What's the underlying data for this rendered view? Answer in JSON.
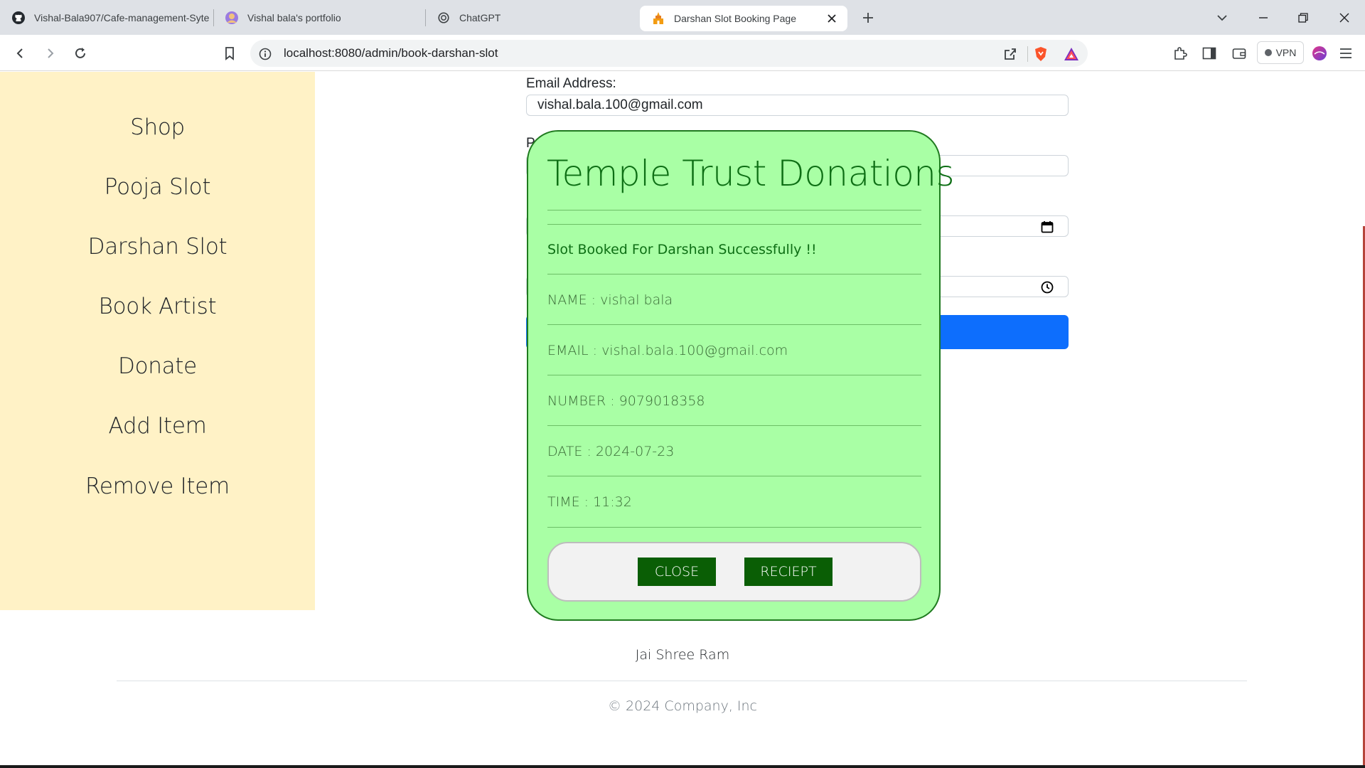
{
  "browser": {
    "tabs": [
      {
        "title": "Vishal-Bala907/Cafe-management-Syte",
        "icon": "github-icon"
      },
      {
        "title": "Vishal bala's portfolio",
        "icon": "avatar-icon"
      },
      {
        "title": "ChatGPT",
        "icon": "chatgpt-icon"
      },
      {
        "title": "Darshan Slot Booking Page",
        "icon": "temple-icon",
        "active": true
      }
    ],
    "url": "localhost:8080/admin/book-darshan-slot",
    "vpn_label": "VPN"
  },
  "sidebar": {
    "items": [
      {
        "label": "Shop"
      },
      {
        "label": "Pooja Slot"
      },
      {
        "label": "Darshan Slot"
      },
      {
        "label": "Book Artist"
      },
      {
        "label": "Donate"
      },
      {
        "label": "Add Item"
      },
      {
        "label": "Remove Item"
      }
    ]
  },
  "form": {
    "email_label": "Email Address:",
    "email_value": "vishal.bala.100@gmail.com",
    "phone_label_partial": "P",
    "submit_color": "#0d6efd"
  },
  "modal": {
    "title": "Temple Trust Donations",
    "message": "Slot Booked For Darshan Successfully !!",
    "rows": [
      {
        "text": "NAME : vishal bala"
      },
      {
        "text": "EMAIL : vishal.bala.100@gmail.com"
      },
      {
        "text": "NUMBER : 9079018358"
      },
      {
        "text": "DATE : 2024-07-23"
      },
      {
        "text": "TIME : 11:32"
      }
    ],
    "close_label": "CLOSE",
    "receipt_label": "RECIEPT",
    "bg_color": "#a9ffa5",
    "button_color": "#0a5e05"
  },
  "footer": {
    "text": "Jai Shree Ram",
    "copyright": "© 2024 Company, Inc"
  }
}
